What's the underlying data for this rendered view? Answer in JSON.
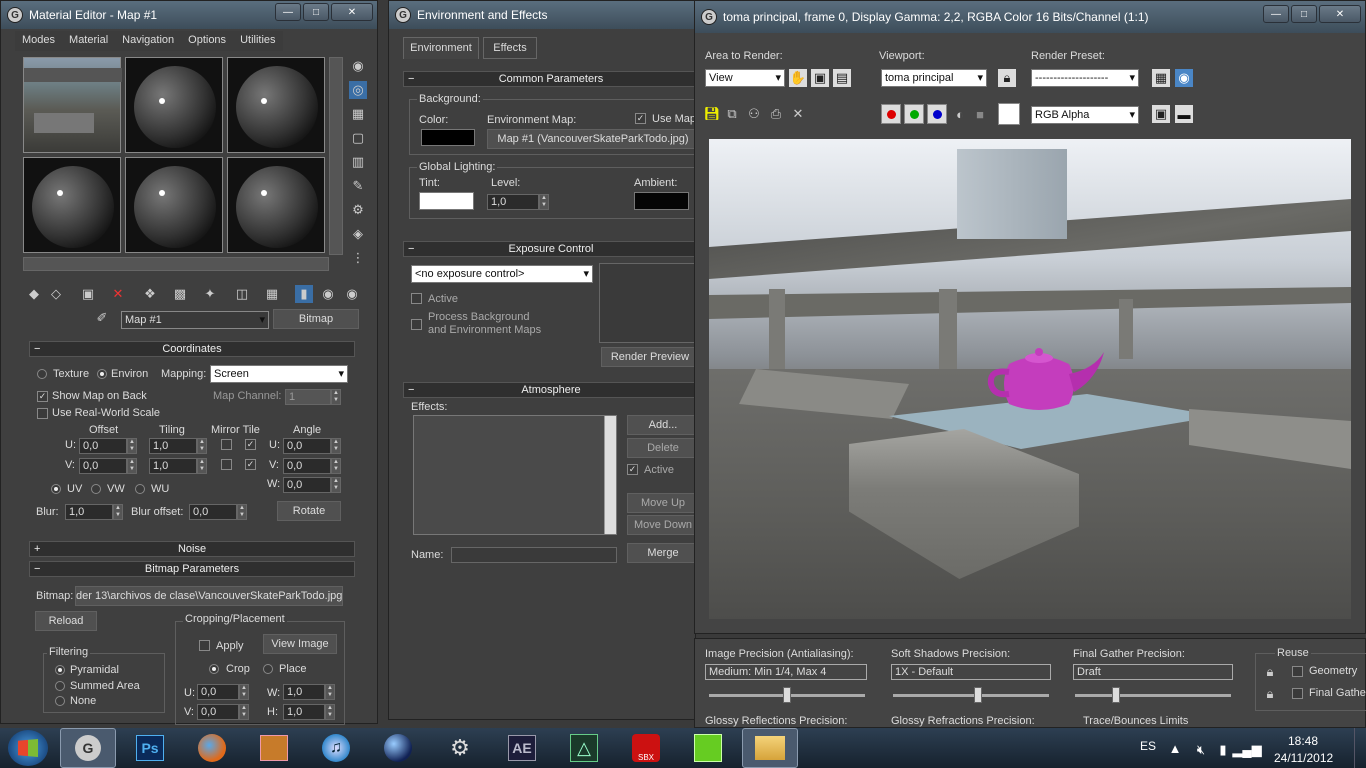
{
  "material_editor": {
    "title": "Material Editor - Map #1",
    "menu": [
      "Modes",
      "Material",
      "Navigation",
      "Options",
      "Utilities"
    ],
    "map_name": "Map #1",
    "map_type": "Bitmap",
    "coordinates": {
      "header": "Coordinates",
      "texture_label": "Texture",
      "environ_label": "Environ",
      "mapping_label": "Mapping:",
      "mapping_value": "Screen",
      "show_map_on_back": "Show Map on Back",
      "map_channel_label": "Map Channel:",
      "map_channel_value": "1",
      "use_real_world": "Use Real-World Scale",
      "offset_label": "Offset",
      "tiling_label": "Tiling",
      "mirror_tile_label": "Mirror Tile",
      "angle_label": "Angle",
      "u_label": "U:",
      "v_label": "V:",
      "w_label": "W:",
      "offset_u": "0,0",
      "offset_v": "0,0",
      "tiling_u": "1,0",
      "tiling_v": "1,0",
      "angle_u": "0,0",
      "angle_v": "0,0",
      "angle_w": "0,0",
      "uv": "UV",
      "vw": "VW",
      "wu": "WU",
      "blur_label": "Blur:",
      "blur_value": "1,0",
      "blur_offset_label": "Blur offset:",
      "blur_offset_value": "0,0",
      "rotate": "Rotate"
    },
    "noise_header": "Noise",
    "bitmap_params": {
      "header": "Bitmap Parameters",
      "bitmap_label": "Bitmap:",
      "bitmap_path": "der 13\\archivos de clase\\VancouverSkateParkTodo.jpg",
      "reload": "Reload",
      "cropping_label": "Cropping/Placement",
      "apply": "Apply",
      "view_image": "View Image",
      "crop": "Crop",
      "place": "Place",
      "filtering_label": "Filtering",
      "pyramidal": "Pyramidal",
      "summed_area": "Summed Area",
      "none": "None",
      "u_label": "U:",
      "v_label": "V:",
      "w_label": "W:",
      "h_label": "H:",
      "u_value": "0,0",
      "v_value": "0,0",
      "w_value": "1,0",
      "h_value": "1,0"
    }
  },
  "env_effects": {
    "title": "Environment and Effects",
    "tabs": [
      "Environment",
      "Effects"
    ],
    "common_params": "Common Parameters",
    "background": "Background:",
    "color": "Color:",
    "env_map": "Environment Map:",
    "use_map": "Use Map",
    "map_button": "Map #1 (VancouverSkateParkTodo.jpg)",
    "global_lighting": "Global Lighting:",
    "tint": "Tint:",
    "level": "Level:",
    "level_value": "1,0",
    "ambient": "Ambient:",
    "exposure_header": "Exposure Control",
    "exposure_value": "<no exposure control>",
    "active": "Active",
    "process_bg_1": "Process Background",
    "process_bg_2": "and Environment Maps",
    "render_preview": "Render Preview",
    "atmosphere_header": "Atmosphere",
    "effects_label": "Effects:",
    "add": "Add...",
    "delete": "Delete",
    "active2": "Active",
    "move_up": "Move Up",
    "move_down": "Move Down",
    "name_label": "Name:",
    "merge": "Merge"
  },
  "render_frame": {
    "title": "toma principal, frame 0, Display Gamma: 2,2, RGBA Color 16 Bits/Channel (1:1)",
    "area_label": "Area to Render:",
    "area_value": "View",
    "viewport_label": "Viewport:",
    "viewport_value": "toma principal",
    "preset_label": "Render Preset:",
    "preset_value": "--------------------",
    "channel_value": "RGB Alpha"
  },
  "render_settings": {
    "image_precision": "Image Precision (Antialiasing):",
    "image_precision_value": "Medium: Min 1/4, Max 4",
    "soft_shadows": "Soft Shadows Precision:",
    "soft_shadows_value": "1X - Default",
    "final_gather": "Final Gather Precision:",
    "final_gather_value": "Draft",
    "reuse": "Reuse",
    "geometry": "Geometry",
    "final_gather_chk": "Final Gather",
    "glossy_reflections": "Glossy Reflections Precision:",
    "glossy_refractions": "Glossy Refractions Precision:",
    "trace_bounces": "Trace/Bounces Limits",
    "image_precision_level": 0.5,
    "soft_shadows_level": 0.55,
    "final_gather_level": 0.25
  },
  "taskbar": {
    "apps": [
      "3ds Max",
      "Ps",
      "Firefox",
      "Archive",
      "iTunes",
      "Globe",
      "Tools",
      "AE",
      "Draw",
      "SBX",
      "Green",
      "Folder"
    ],
    "lang": "ES",
    "time": "18:48",
    "date": "24/11/2012"
  },
  "colors": {
    "teapot": "#c43dbd",
    "title_blue": "#4a5a68",
    "taskbar": "#1c2a3a"
  }
}
